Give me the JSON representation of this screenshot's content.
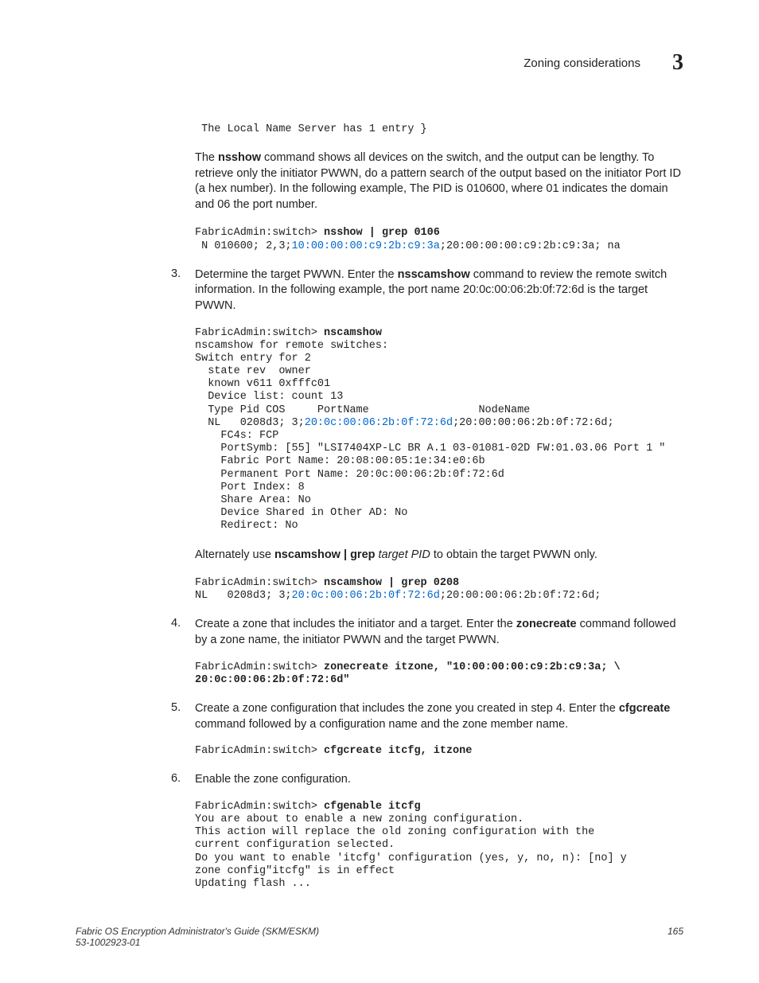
{
  "header": {
    "title": "Zoning considerations",
    "chapter": "3"
  },
  "intro_code": " The Local Name Server has 1 entry }",
  "nsshow_para": {
    "p1a": "The ",
    "p1b": "nsshow",
    "p1c": " command shows all devices on the switch, and the output can be lengthy. To retrieve only the initiator PWWN, do a pattern search of the output based on the initiator Port ID (a hex number). In the following example, The PID is 010600, where 01 indicates the domain and 06 the port number."
  },
  "code_nsshow": {
    "prompt": "FabricAdmin:switch> ",
    "cmd": "nsshow | grep 0106",
    "line2a": " N 010600; 2,3;",
    "line2b": "10:00:00:00:c9:2b:c9:3a",
    "line2c": ";20:00:00:00:c9:2b:c9:3a; na"
  },
  "step3": {
    "num": "3.",
    "p1a": "Determine the target PWWN. Enter the ",
    "p1b": "nsscamshow",
    "p1c": " command to review the remote switch information. In the following example, the port name 20:0c:00:06:2b:0f:72:6d is the target PWWN."
  },
  "code_nscam": {
    "prompt": "FabricAdmin:switch> ",
    "cmd": "nscamshow",
    "l1": "nscamshow for remote switches:",
    "l2": "Switch entry for 2",
    "l3": "  state rev  owner",
    "l4": "  known v611 0xfffc01",
    "l5": "  Device list: count 13",
    "l6": "  Type Pid COS     PortName                 NodeName",
    "l7a": "  NL   0208d3; 3;",
    "l7b": "20:0c:00:06:2b:0f:72:6d",
    "l7c": ";20:00:00:06:2b:0f:72:6d;",
    "l8": "    FC4s: FCP",
    "l9": "    PortSymb: [55] \"LSI7404XP-LC BR A.1 03-01081-02D FW:01.03.06 Port 1 \"",
    "l10": "    Fabric Port Name: 20:08:00:05:1e:34:e0:6b",
    "l11": "    Permanent Port Name: 20:0c:00:06:2b:0f:72:6d",
    "l12": "    Port Index: 8",
    "l13": "    Share Area: No",
    "l14": "    Device Shared in Other AD: No",
    "l15": "    Redirect: No"
  },
  "alt_para": {
    "a": "Alternately use ",
    "b": "nscamshow | grep ",
    "c": "target PID",
    "d": " to obtain the target PWWN only."
  },
  "code_nscam2": {
    "prompt": "FabricAdmin:switch> ",
    "cmd": "nscamshow | grep 0208",
    "l1a": "NL   0208d3; 3;",
    "l1b": "20:0c:00:06:2b:0f:72:6d",
    "l1c": ";20:00:00:06:2b:0f:72:6d;"
  },
  "step4": {
    "num": "4.",
    "a": "Create a zone that includes the initiator and a target. Enter the ",
    "b": "zonecreate",
    "c": " command followed by a zone name, the initiator PWWN and the target PWWN."
  },
  "code_zonecreate": {
    "prompt": "FabricAdmin:switch> ",
    "cmd": "zonecreate itzone, \"10:00:00:00:c9:2b:c9:3a; \\\n20:0c:00:06:2b:0f:72:6d\""
  },
  "step5": {
    "num": "5.",
    "a": "Create a zone configuration that includes the zone you created in step 4. Enter the ",
    "b": "cfgcreate",
    "c": " command followed by a configuration name and the zone member name."
  },
  "code_cfgcreate": {
    "prompt": "FabricAdmin:switch> ",
    "cmd": "cfgcreate itcfg, itzone"
  },
  "step6": {
    "num": "6.",
    "a": "Enable the zone configuration."
  },
  "code_cfgenable": {
    "prompt": "FabricAdmin:switch> ",
    "cmd": "cfgenable itcfg",
    "l1": "You are about to enable a new zoning configuration.",
    "l2": "This action will replace the old zoning configuration with the",
    "l3": "current configuration selected.",
    "l4": "Do you want to enable 'itcfg' configuration (yes, y, no, n): [no] y",
    "l5": "zone config\"itcfg\" is in effect",
    "l6": "Updating flash ..."
  },
  "footer": {
    "title": "Fabric OS Encryption Administrator's Guide (SKM/ESKM)",
    "docnum": "53-1002923-01",
    "page": "165"
  }
}
